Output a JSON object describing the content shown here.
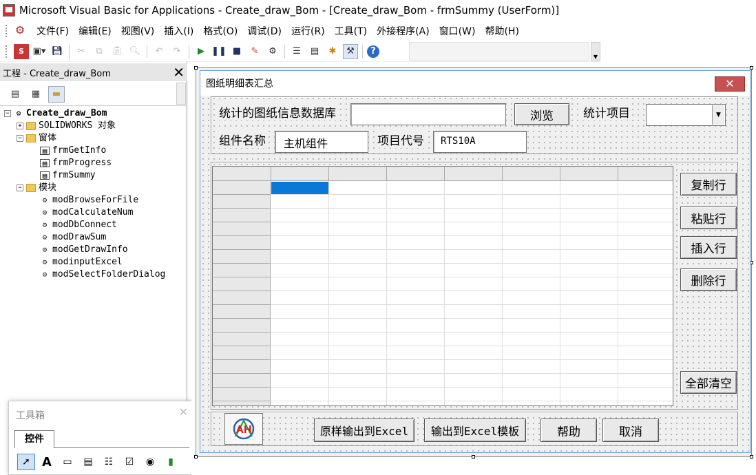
{
  "window": {
    "title": "Microsoft Visual Basic for Applications - Create_draw_Bom - [Create_draw_Bom - frmSummy (UserForm)]"
  },
  "menu": [
    "文件(F)",
    "编辑(E)",
    "视图(V)",
    "插入(I)",
    "格式(O)",
    "调试(D)",
    "运行(R)",
    "工具(T)",
    "外接程序(A)",
    "窗口(W)",
    "帮助(H)"
  ],
  "toolbar": {
    "icons": [
      "excel-icon",
      "insert-userform-icon",
      "save-icon",
      "cut-icon",
      "copy-icon",
      "paste-icon",
      "find-icon",
      "undo-icon",
      "redo-icon",
      "run-icon",
      "break-icon",
      "reset-icon",
      "design-mode-icon",
      "project-explorer-icon",
      "properties-icon",
      "object-browser-icon",
      "toolbox-icon",
      "help-icon"
    ]
  },
  "project": {
    "title": "工程 - Create_draw_Bom",
    "close": "✕",
    "root": "Create_draw_Bom",
    "solidworks": "SOLIDWORKS 对象",
    "forms_folder": "窗体",
    "forms": [
      "frmGetInfo",
      "frmProgress",
      "frmSummy"
    ],
    "modules_folder": "模块",
    "modules": [
      "modBrowseForFile",
      "modCalculateNum",
      "modDbConnect",
      "modDrawSum",
      "modGetDrawInfo",
      "modinputExcel",
      "modSelectFolderDialog"
    ]
  },
  "toolbox": {
    "title": "工具箱",
    "tab": "控件",
    "tools": [
      "select-objects-icon",
      "label-icon",
      "textbox-icon",
      "combobox-icon",
      "listbox-icon",
      "checkbox-icon",
      "optionbutton-icon",
      "togglebutton-icon"
    ]
  },
  "userform": {
    "title": "图纸明细表汇总",
    "close": "✕",
    "db_label": "统计的图纸信息数据库",
    "db_value": "",
    "browse": "浏览",
    "stat_label": "统计项目",
    "stat_value": "",
    "assembly_label": "组件名称",
    "assembly_value": "主机组件",
    "project_label": "项目代号",
    "project_value": "RTS10A",
    "side_buttons": [
      "复制行",
      "粘贴行",
      "插入行",
      "删除行"
    ],
    "clear_all": "全部清空",
    "logo_text": "AH",
    "bottom_buttons": [
      "原样输出到Excel",
      "输出到Excel模板",
      "帮助",
      "取消"
    ]
  }
}
